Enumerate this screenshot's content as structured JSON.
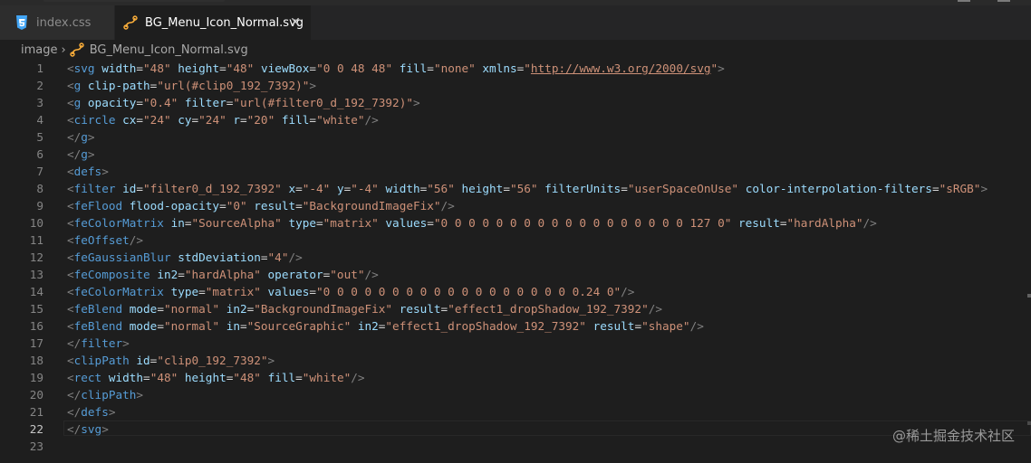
{
  "tabs": [
    {
      "label": "index.css",
      "icon": "css-file-icon",
      "active": false
    },
    {
      "label": "BG_Menu_Icon_Normal.svg",
      "icon": "svg-file-icon",
      "active": true,
      "close": "✕"
    }
  ],
  "breadcrumb": {
    "folder": "image",
    "separator": "›",
    "file": "BG_Menu_Icon_Normal.svg"
  },
  "editor": {
    "current_line": 22,
    "lines": [
      {
        "n": "1",
        "tokens": [
          [
            "p",
            "<"
          ],
          [
            "tag",
            "svg"
          ],
          [
            "sp",
            " "
          ],
          [
            "att",
            "width"
          ],
          [
            "eq",
            "="
          ],
          [
            "str",
            "\"48\""
          ],
          [
            "sp",
            " "
          ],
          [
            "att",
            "height"
          ],
          [
            "eq",
            "="
          ],
          [
            "str",
            "\"48\""
          ],
          [
            "sp",
            " "
          ],
          [
            "att",
            "viewBox"
          ],
          [
            "eq",
            "="
          ],
          [
            "str",
            "\"0 0 48 48\""
          ],
          [
            "sp",
            " "
          ],
          [
            "att",
            "fill"
          ],
          [
            "eq",
            "="
          ],
          [
            "str",
            "\"none\""
          ],
          [
            "sp",
            " "
          ],
          [
            "att",
            "xmlns"
          ],
          [
            "eq",
            "="
          ],
          [
            "str",
            "\""
          ],
          [
            "url",
            "http://www.w3.org/2000/svg"
          ],
          [
            "str",
            "\""
          ],
          [
            "p",
            ">"
          ]
        ]
      },
      {
        "n": "2",
        "tokens": [
          [
            "p",
            "<"
          ],
          [
            "tag",
            "g"
          ],
          [
            "sp",
            " "
          ],
          [
            "att",
            "clip-path"
          ],
          [
            "eq",
            "="
          ],
          [
            "str",
            "\"url(#clip0_192_7392)\""
          ],
          [
            "p",
            ">"
          ]
        ]
      },
      {
        "n": "3",
        "tokens": [
          [
            "p",
            "<"
          ],
          [
            "tag",
            "g"
          ],
          [
            "sp",
            " "
          ],
          [
            "att",
            "opacity"
          ],
          [
            "eq",
            "="
          ],
          [
            "str",
            "\"0.4\""
          ],
          [
            "sp",
            " "
          ],
          [
            "att",
            "filter"
          ],
          [
            "eq",
            "="
          ],
          [
            "str",
            "\"url(#filter0_d_192_7392)\""
          ],
          [
            "p",
            ">"
          ]
        ]
      },
      {
        "n": "4",
        "tokens": [
          [
            "p",
            "<"
          ],
          [
            "tag",
            "circle"
          ],
          [
            "sp",
            " "
          ],
          [
            "att",
            "cx"
          ],
          [
            "eq",
            "="
          ],
          [
            "str",
            "\"24\""
          ],
          [
            "sp",
            " "
          ],
          [
            "att",
            "cy"
          ],
          [
            "eq",
            "="
          ],
          [
            "str",
            "\"24\""
          ],
          [
            "sp",
            " "
          ],
          [
            "att",
            "r"
          ],
          [
            "eq",
            "="
          ],
          [
            "str",
            "\"20\""
          ],
          [
            "sp",
            " "
          ],
          [
            "att",
            "fill"
          ],
          [
            "eq",
            "="
          ],
          [
            "str",
            "\"white\""
          ],
          [
            "p",
            "/>"
          ]
        ]
      },
      {
        "n": "5",
        "tokens": [
          [
            "p",
            "</"
          ],
          [
            "tag",
            "g"
          ],
          [
            "p",
            ">"
          ]
        ]
      },
      {
        "n": "6",
        "tokens": [
          [
            "p",
            "</"
          ],
          [
            "tag",
            "g"
          ],
          [
            "p",
            ">"
          ]
        ]
      },
      {
        "n": "7",
        "tokens": [
          [
            "p",
            "<"
          ],
          [
            "tag",
            "defs"
          ],
          [
            "p",
            ">"
          ]
        ]
      },
      {
        "n": "8",
        "tokens": [
          [
            "p",
            "<"
          ],
          [
            "tag",
            "filter"
          ],
          [
            "sp",
            " "
          ],
          [
            "att",
            "id"
          ],
          [
            "eq",
            "="
          ],
          [
            "str",
            "\"filter0_d_192_7392\""
          ],
          [
            "sp",
            " "
          ],
          [
            "att",
            "x"
          ],
          [
            "eq",
            "="
          ],
          [
            "str",
            "\"-4\""
          ],
          [
            "sp",
            " "
          ],
          [
            "att",
            "y"
          ],
          [
            "eq",
            "="
          ],
          [
            "str",
            "\"-4\""
          ],
          [
            "sp",
            " "
          ],
          [
            "att",
            "width"
          ],
          [
            "eq",
            "="
          ],
          [
            "str",
            "\"56\""
          ],
          [
            "sp",
            " "
          ],
          [
            "att",
            "height"
          ],
          [
            "eq",
            "="
          ],
          [
            "str",
            "\"56\""
          ],
          [
            "sp",
            " "
          ],
          [
            "att",
            "filterUnits"
          ],
          [
            "eq",
            "="
          ],
          [
            "str",
            "\"userSpaceOnUse\""
          ],
          [
            "sp",
            " "
          ],
          [
            "att",
            "color-interpolation-filters"
          ],
          [
            "eq",
            "="
          ],
          [
            "str",
            "\"sRGB\""
          ],
          [
            "p",
            ">"
          ]
        ]
      },
      {
        "n": "9",
        "tokens": [
          [
            "p",
            "<"
          ],
          [
            "tag",
            "feFlood"
          ],
          [
            "sp",
            " "
          ],
          [
            "att",
            "flood-opacity"
          ],
          [
            "eq",
            "="
          ],
          [
            "str",
            "\"0\""
          ],
          [
            "sp",
            " "
          ],
          [
            "att",
            "result"
          ],
          [
            "eq",
            "="
          ],
          [
            "str",
            "\"BackgroundImageFix\""
          ],
          [
            "p",
            "/>"
          ]
        ]
      },
      {
        "n": "10",
        "tokens": [
          [
            "p",
            "<"
          ],
          [
            "tag",
            "feColorMatrix"
          ],
          [
            "sp",
            " "
          ],
          [
            "att",
            "in"
          ],
          [
            "eq",
            "="
          ],
          [
            "str",
            "\"SourceAlpha\""
          ],
          [
            "sp",
            " "
          ],
          [
            "att",
            "type"
          ],
          [
            "eq",
            "="
          ],
          [
            "str",
            "\"matrix\""
          ],
          [
            "sp",
            " "
          ],
          [
            "att",
            "values"
          ],
          [
            "eq",
            "="
          ],
          [
            "str",
            "\"0 0 0 0 0 0 0 0 0 0 0 0 0 0 0 0 0 0 127 0\""
          ],
          [
            "sp",
            " "
          ],
          [
            "att",
            "result"
          ],
          [
            "eq",
            "="
          ],
          [
            "str",
            "\"hardAlpha\""
          ],
          [
            "p",
            "/>"
          ]
        ]
      },
      {
        "n": "11",
        "tokens": [
          [
            "p",
            "<"
          ],
          [
            "tag",
            "feOffset"
          ],
          [
            "p",
            "/>"
          ]
        ]
      },
      {
        "n": "12",
        "tokens": [
          [
            "p",
            "<"
          ],
          [
            "tag",
            "feGaussianBlur"
          ],
          [
            "sp",
            " "
          ],
          [
            "att",
            "stdDeviation"
          ],
          [
            "eq",
            "="
          ],
          [
            "str",
            "\"4\""
          ],
          [
            "p",
            "/>"
          ]
        ]
      },
      {
        "n": "13",
        "tokens": [
          [
            "p",
            "<"
          ],
          [
            "tag",
            "feComposite"
          ],
          [
            "sp",
            " "
          ],
          [
            "att",
            "in2"
          ],
          [
            "eq",
            "="
          ],
          [
            "str",
            "\"hardAlpha\""
          ],
          [
            "sp",
            " "
          ],
          [
            "att",
            "operator"
          ],
          [
            "eq",
            "="
          ],
          [
            "str",
            "\"out\""
          ],
          [
            "p",
            "/>"
          ]
        ]
      },
      {
        "n": "14",
        "tokens": [
          [
            "p",
            "<"
          ],
          [
            "tag",
            "feColorMatrix"
          ],
          [
            "sp",
            " "
          ],
          [
            "att",
            "type"
          ],
          [
            "eq",
            "="
          ],
          [
            "str",
            "\"matrix\""
          ],
          [
            "sp",
            " "
          ],
          [
            "att",
            "values"
          ],
          [
            "eq",
            "="
          ],
          [
            "str",
            "\"0 0 0 0 0 0 0 0 0 0 0 0 0 0 0 0 0 0 0.24 0\""
          ],
          [
            "p",
            "/>"
          ]
        ]
      },
      {
        "n": "15",
        "tokens": [
          [
            "p",
            "<"
          ],
          [
            "tag",
            "feBlend"
          ],
          [
            "sp",
            " "
          ],
          [
            "att",
            "mode"
          ],
          [
            "eq",
            "="
          ],
          [
            "str",
            "\"normal\""
          ],
          [
            "sp",
            " "
          ],
          [
            "att",
            "in2"
          ],
          [
            "eq",
            "="
          ],
          [
            "str",
            "\"BackgroundImageFix\""
          ],
          [
            "sp",
            " "
          ],
          [
            "att",
            "result"
          ],
          [
            "eq",
            "="
          ],
          [
            "str",
            "\"effect1_dropShadow_192_7392\""
          ],
          [
            "p",
            "/>"
          ]
        ]
      },
      {
        "n": "16",
        "tokens": [
          [
            "p",
            "<"
          ],
          [
            "tag",
            "feBlend"
          ],
          [
            "sp",
            " "
          ],
          [
            "att",
            "mode"
          ],
          [
            "eq",
            "="
          ],
          [
            "str",
            "\"normal\""
          ],
          [
            "sp",
            " "
          ],
          [
            "att",
            "in"
          ],
          [
            "eq",
            "="
          ],
          [
            "str",
            "\"SourceGraphic\""
          ],
          [
            "sp",
            " "
          ],
          [
            "att",
            "in2"
          ],
          [
            "eq",
            "="
          ],
          [
            "str",
            "\"effect1_dropShadow_192_7392\""
          ],
          [
            "sp",
            " "
          ],
          [
            "att",
            "result"
          ],
          [
            "eq",
            "="
          ],
          [
            "str",
            "\"shape\""
          ],
          [
            "p",
            "/>"
          ]
        ]
      },
      {
        "n": "17",
        "tokens": [
          [
            "p",
            "</"
          ],
          [
            "tag",
            "filter"
          ],
          [
            "p",
            ">"
          ]
        ]
      },
      {
        "n": "18",
        "tokens": [
          [
            "p",
            "<"
          ],
          [
            "tag",
            "clipPath"
          ],
          [
            "sp",
            " "
          ],
          [
            "att",
            "id"
          ],
          [
            "eq",
            "="
          ],
          [
            "str",
            "\"clip0_192_7392\""
          ],
          [
            "p",
            ">"
          ]
        ]
      },
      {
        "n": "19",
        "tokens": [
          [
            "p",
            "<"
          ],
          [
            "tag",
            "rect"
          ],
          [
            "sp",
            " "
          ],
          [
            "att",
            "width"
          ],
          [
            "eq",
            "="
          ],
          [
            "str",
            "\"48\""
          ],
          [
            "sp",
            " "
          ],
          [
            "att",
            "height"
          ],
          [
            "eq",
            "="
          ],
          [
            "str",
            "\"48\""
          ],
          [
            "sp",
            " "
          ],
          [
            "att",
            "fill"
          ],
          [
            "eq",
            "="
          ],
          [
            "str",
            "\"white\""
          ],
          [
            "p",
            "/>"
          ]
        ]
      },
      {
        "n": "20",
        "tokens": [
          [
            "p",
            "</"
          ],
          [
            "tag",
            "clipPath"
          ],
          [
            "p",
            ">"
          ]
        ]
      },
      {
        "n": "21",
        "tokens": [
          [
            "p",
            "</"
          ],
          [
            "tag",
            "defs"
          ],
          [
            "p",
            ">"
          ]
        ]
      },
      {
        "n": "22",
        "tokens": [
          [
            "p",
            "</"
          ],
          [
            "tag",
            "svg"
          ],
          [
            "p",
            ">"
          ]
        ]
      },
      {
        "n": "23",
        "tokens": []
      }
    ]
  },
  "watermark": "@稀土掘金技术社区",
  "colors": {
    "tag": "#569cd6",
    "attribute": "#9cdcfe",
    "string": "#ce9178",
    "punctuation": "#808080",
    "line_number": "#858585"
  }
}
